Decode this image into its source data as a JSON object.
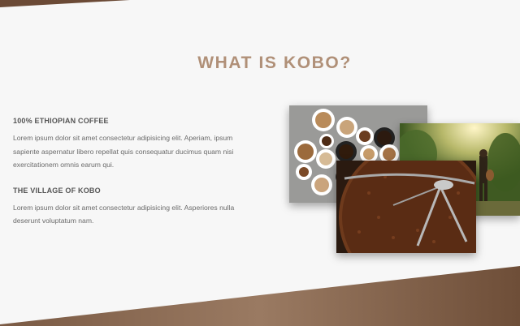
{
  "section": {
    "title": "WHAT IS KOBO?"
  },
  "blocks": [
    {
      "heading": "100% ETHIOPIAN COFFEE",
      "body": "Lorem ipsum dolor sit amet consectetur adipisicing elit. Aperiam, ipsum sapiente aspernatur libero repellat quis consequatur ducimus quam nisi exercitationem omnis earum qui."
    },
    {
      "heading": "THE VILLAGE OF KOBO",
      "body": "Lorem ipsum dolor sit amet consectetur adipisicing elit. Asperiores nulla deserunt voluptatum nam."
    }
  ],
  "images": [
    {
      "name": "coffee-cups-photo"
    },
    {
      "name": "coffee-farm-photo"
    },
    {
      "name": "coffee-roasting-photo"
    }
  ],
  "colors": {
    "background": "#f7f7f7",
    "title": "#b09078",
    "bottom_band": "#8a6a52"
  }
}
